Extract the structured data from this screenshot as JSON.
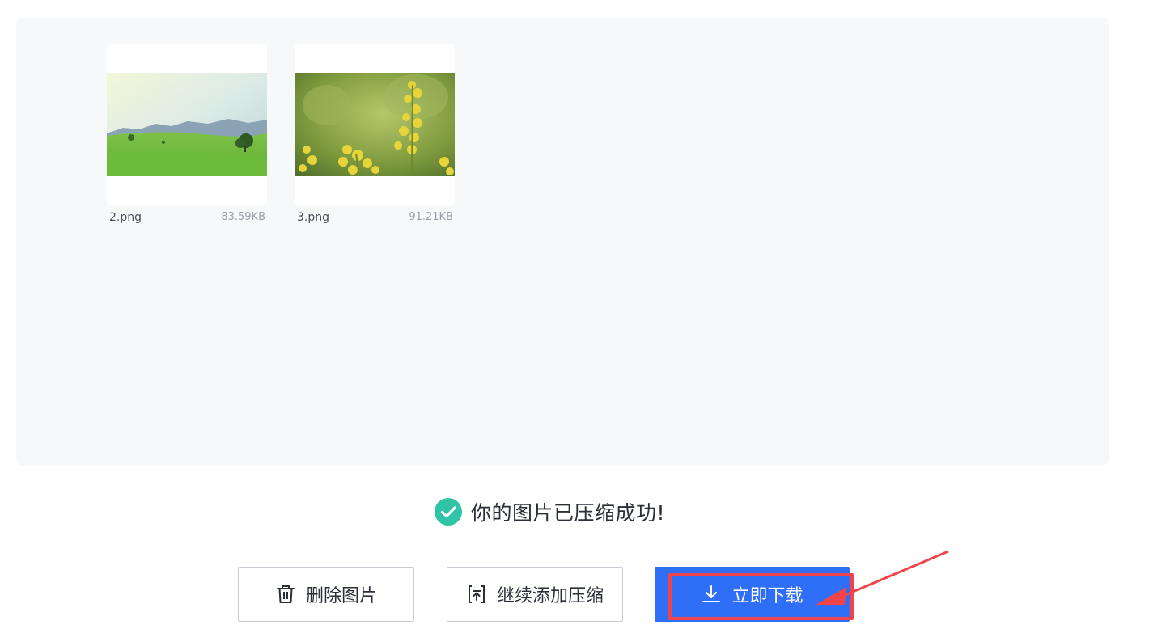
{
  "files": [
    {
      "name": "2.png",
      "size": "83.59KB",
      "thumbnail": "meadow-landscape"
    },
    {
      "name": "3.png",
      "size": "91.21KB",
      "thumbnail": "yellow-rapeseed-flowers"
    }
  ],
  "status": {
    "message": "你的图片已压缩成功!",
    "icon": "check-circle-icon",
    "color": "#2ec4a5"
  },
  "actions": {
    "delete_label": "删除图片",
    "add_more_label": "继续添加压缩",
    "download_label": "立即下载"
  },
  "colors": {
    "primary": "#2f6ef6",
    "annotation": "#f0444b",
    "panel_bg": "#f7f8fa"
  }
}
